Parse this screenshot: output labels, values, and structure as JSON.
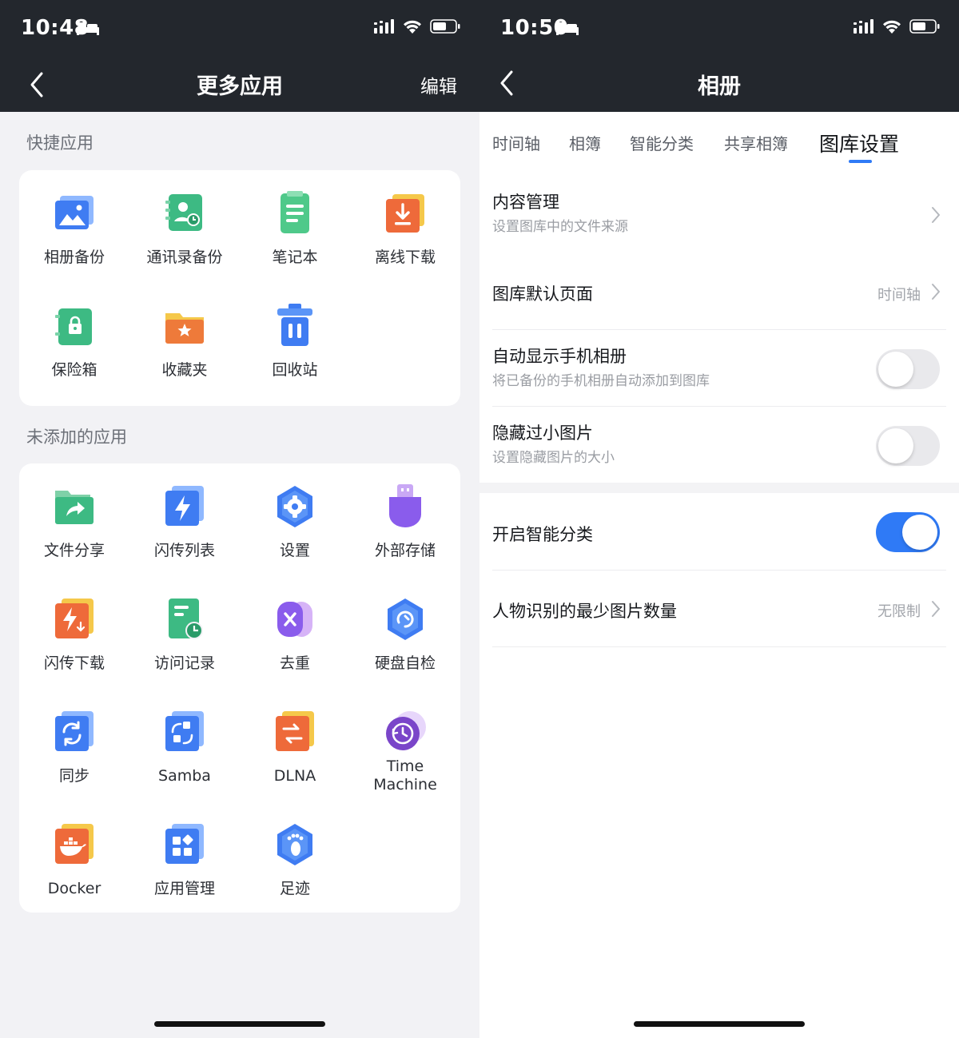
{
  "left": {
    "status": {
      "time": "10:48"
    },
    "nav": {
      "title": "更多应用",
      "edit_label": "编辑"
    },
    "quick": {
      "title": "快捷应用",
      "apps": [
        {
          "label": "相册备份",
          "icon": "photo-album-icon"
        },
        {
          "label": "通讯录备份",
          "icon": "contacts-backup-icon"
        },
        {
          "label": "笔记本",
          "icon": "notebook-icon"
        },
        {
          "label": "离线下载",
          "icon": "offline-download-icon"
        },
        {
          "label": "保险箱",
          "icon": "safe-box-icon"
        },
        {
          "label": "收藏夹",
          "icon": "favorites-folder-icon"
        },
        {
          "label": "回收站",
          "icon": "trash-icon"
        }
      ]
    },
    "unadded": {
      "title": "未添加的应用",
      "apps": [
        {
          "label": "文件分享",
          "icon": "file-share-icon"
        },
        {
          "label": "闪传列表",
          "icon": "flash-transfer-list-icon"
        },
        {
          "label": "设置",
          "icon": "settings-gear-icon"
        },
        {
          "label": "外部存储",
          "icon": "usb-storage-icon"
        },
        {
          "label": "闪传下载",
          "icon": "flash-download-icon"
        },
        {
          "label": "访问记录",
          "icon": "access-log-icon"
        },
        {
          "label": "去重",
          "icon": "deduplicate-icon"
        },
        {
          "label": "硬盘自检",
          "icon": "disk-check-icon"
        },
        {
          "label": "同步",
          "icon": "sync-icon"
        },
        {
          "label": "Samba",
          "icon": "samba-icon"
        },
        {
          "label": "DLNA",
          "icon": "dlna-icon"
        },
        {
          "label": "Time\nMachine",
          "icon": "time-machine-icon"
        },
        {
          "label": "Docker",
          "icon": "docker-icon"
        },
        {
          "label": "应用管理",
          "icon": "app-management-icon"
        },
        {
          "label": "足迹",
          "icon": "footprint-icon"
        }
      ]
    }
  },
  "right": {
    "status": {
      "time": "10:50"
    },
    "nav": {
      "title": "相册"
    },
    "tabs": [
      "时间轴",
      "相簿",
      "智能分类",
      "共享相簿",
      "图库设置"
    ],
    "active_tab": 4,
    "settings": {
      "content_mgmt": {
        "title": "内容管理",
        "sub": "设置图库中的文件来源"
      },
      "default_page": {
        "title": "图库默认页面",
        "value": "时间轴"
      },
      "auto_show": {
        "title": "自动显示手机相册",
        "sub": "将已备份的手机相册自动添加到图库",
        "on": false
      },
      "hide_small": {
        "title": "隐藏过小图片",
        "sub": "设置隐藏图片的大小",
        "on": false
      },
      "smart_class": {
        "title": "开启智能分类",
        "on": true
      },
      "min_photos": {
        "title": "人物识别的最少图片数量",
        "value": "无限制"
      }
    }
  },
  "colors": {
    "accent": "#2f7af6",
    "nav_bg": "#23272d",
    "page_bg": "#f2f2f5"
  }
}
